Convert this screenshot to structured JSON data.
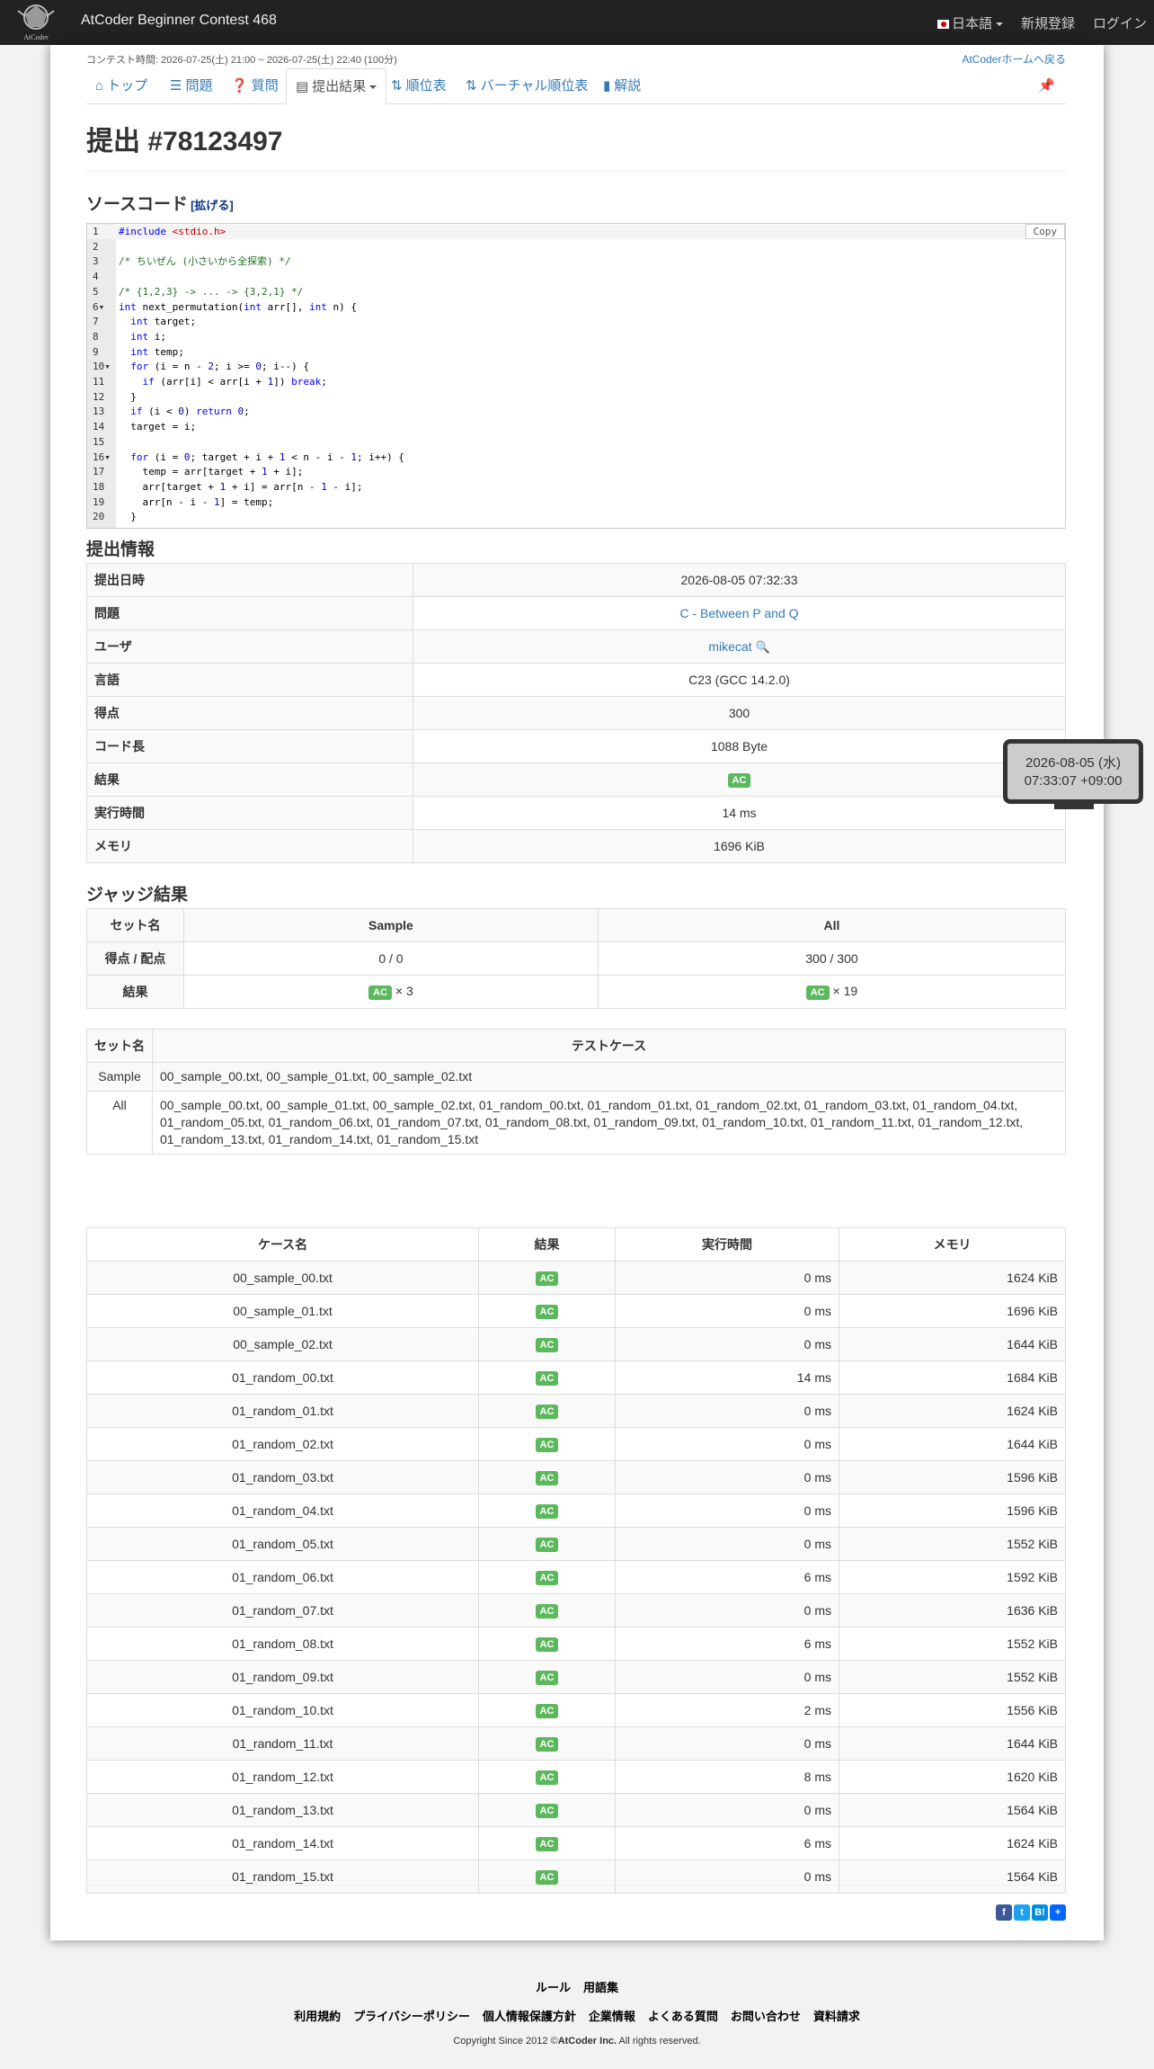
{
  "navbar": {
    "brand": "AtCoder Beginner Contest 468",
    "logo_text": "AtCoder",
    "lang": "日本語",
    "signup": "新規登録",
    "login": "ログイン"
  },
  "contest": {
    "time": "コンテスト時間: 2026-07-25(土) 21:00 ~ 2026-07-25(土) 22:40 (100分)",
    "home_link": "AtCoderホームへ戻る"
  },
  "tabs": [
    {
      "label": "トップ",
      "icon": "home-icon"
    },
    {
      "label": "問題",
      "icon": "tasks-icon"
    },
    {
      "label": "質問",
      "icon": "question-icon"
    },
    {
      "label": "提出結果",
      "icon": "list-icon"
    },
    {
      "label": "順位表",
      "icon": "sort-icon"
    },
    {
      "label": "バーチャル順位表",
      "icon": "sort-icon"
    },
    {
      "label": "解説",
      "icon": "book-icon"
    }
  ],
  "title": "提出 #78123497",
  "source": {
    "heading": "ソースコード",
    "expand": "[拡げる]",
    "copy": "Copy",
    "lines": [
      "#include <stdio.h>",
      "",
      "/* ちいぜん (小さいから全探索) */",
      "",
      "/* {1,2,3} -> ... -> {3,2,1} */",
      "int next_permutation(int arr[], int n) {",
      "  int target;",
      "  int i;",
      "  int temp;",
      "  for (i = n - 2; i >= 0; i--) {",
      "    if (arr[i] < arr[i + 1]) break;",
      "  }",
      "  if (i < 0) return 0;",
      "  target = i;",
      "",
      "  for (i = 0; target + i + 1 < n - i - 1; i++) {",
      "    temp = arr[target + 1 + i];",
      "    arr[target + 1 + i] = arr[n - 1 - i];",
      "    arr[n - i - 1] = temp;",
      "  }"
    ]
  },
  "info": {
    "heading": "提出情報",
    "rows": [
      {
        "label": "提出日時",
        "value": "2026-08-05 07:32:33"
      },
      {
        "label": "問題",
        "value": "C - Between P and Q"
      },
      {
        "label": "ユーザ",
        "value": "mikecat"
      },
      {
        "label": "言語",
        "value": "C23 (GCC 14.2.0)"
      },
      {
        "label": "得点",
        "value": "300"
      },
      {
        "label": "コード長",
        "value": "1088 Byte"
      },
      {
        "label": "結果",
        "value": "AC"
      },
      {
        "label": "実行時間",
        "value": "14 ms"
      },
      {
        "label": "メモリ",
        "value": "1696 KiB"
      }
    ]
  },
  "tooltip": {
    "line1": "2026-08-05 (水)",
    "line2": "07:33:07 +09:00"
  },
  "judge": {
    "heading": "ジャッジ結果",
    "h_set": "セット名",
    "h_sample": "Sample",
    "h_all": "All",
    "score_label": "得点 / 配点",
    "score_sample": "0 / 0",
    "score_all": "300 / 300",
    "result_label": "結果",
    "ac": "AC",
    "count_sample": "× 3",
    "count_all": "× 19"
  },
  "cases": {
    "h_set": "セット名",
    "h_cases": "テストケース",
    "rows": [
      {
        "name": "Sample",
        "files": "00_sample_00.txt, 00_sample_01.txt, 00_sample_02.txt"
      },
      {
        "name": "All",
        "files": "00_sample_00.txt, 00_sample_01.txt, 00_sample_02.txt, 01_random_00.txt, 01_random_01.txt, 01_random_02.txt, 01_random_03.txt, 01_random_04.txt, 01_random_05.txt, 01_random_06.txt, 01_random_07.txt, 01_random_08.txt, 01_random_09.txt, 01_random_10.txt, 01_random_11.txt, 01_random_12.txt, 01_random_13.txt, 01_random_14.txt, 01_random_15.txt"
      }
    ]
  },
  "results": {
    "headers": [
      "ケース名",
      "結果",
      "実行時間",
      "メモリ"
    ],
    "rows": [
      {
        "name": "00_sample_00.txt",
        "status": "AC",
        "time": "0 ms",
        "memory": "1624 KiB"
      },
      {
        "name": "00_sample_01.txt",
        "status": "AC",
        "time": "0 ms",
        "memory": "1696 KiB"
      },
      {
        "name": "00_sample_02.txt",
        "status": "AC",
        "time": "0 ms",
        "memory": "1644 KiB"
      },
      {
        "name": "01_random_00.txt",
        "status": "AC",
        "time": "14 ms",
        "memory": "1684 KiB"
      },
      {
        "name": "01_random_01.txt",
        "status": "AC",
        "time": "0 ms",
        "memory": "1624 KiB"
      },
      {
        "name": "01_random_02.txt",
        "status": "AC",
        "time": "0 ms",
        "memory": "1644 KiB"
      },
      {
        "name": "01_random_03.txt",
        "status": "AC",
        "time": "0 ms",
        "memory": "1596 KiB"
      },
      {
        "name": "01_random_04.txt",
        "status": "AC",
        "time": "0 ms",
        "memory": "1596 KiB"
      },
      {
        "name": "01_random_05.txt",
        "status": "AC",
        "time": "0 ms",
        "memory": "1552 KiB"
      },
      {
        "name": "01_random_06.txt",
        "status": "AC",
        "time": "6 ms",
        "memory": "1592 KiB"
      },
      {
        "name": "01_random_07.txt",
        "status": "AC",
        "time": "0 ms",
        "memory": "1636 KiB"
      },
      {
        "name": "01_random_08.txt",
        "status": "AC",
        "time": "6 ms",
        "memory": "1552 KiB"
      },
      {
        "name": "01_random_09.txt",
        "status": "AC",
        "time": "0 ms",
        "memory": "1552 KiB"
      },
      {
        "name": "01_random_10.txt",
        "status": "AC",
        "time": "2 ms",
        "memory": "1556 KiB"
      },
      {
        "name": "01_random_11.txt",
        "status": "AC",
        "time": "0 ms",
        "memory": "1644 KiB"
      },
      {
        "name": "01_random_12.txt",
        "status": "AC",
        "time": "8 ms",
        "memory": "1620 KiB"
      },
      {
        "name": "01_random_13.txt",
        "status": "AC",
        "time": "0 ms",
        "memory": "1564 KiB"
      },
      {
        "name": "01_random_14.txt",
        "status": "AC",
        "time": "6 ms",
        "memory": "1624 KiB"
      },
      {
        "name": "01_random_15.txt",
        "status": "AC",
        "time": "0 ms",
        "memory": "1564 KiB"
      }
    ]
  },
  "footer": {
    "row1": [
      "ルール",
      "用語集"
    ],
    "row2": [
      "利用規約",
      "プライバシーポリシー",
      "個人情報保護方針",
      "企業情報",
      "よくある質問",
      "お問い合わせ",
      "資料請求"
    ],
    "copyright_prefix": "Copyright Since 2012 ©",
    "copyright_brand": "AtCoder Inc.",
    "copyright_suffix": " All rights reserved."
  },
  "colors": {
    "ac": "#5cb85c",
    "navbar": "#222222",
    "link": "#337ab7"
  }
}
